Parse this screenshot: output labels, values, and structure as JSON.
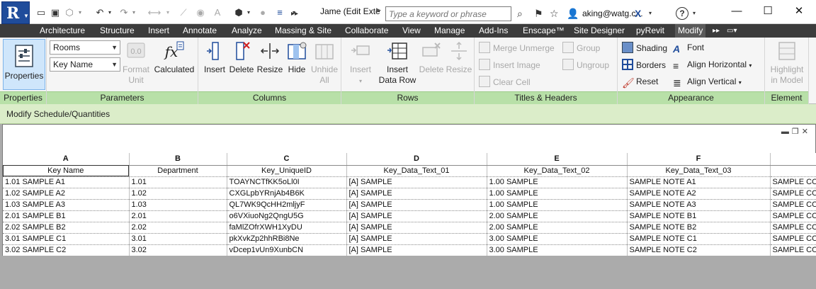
{
  "titlebar": {
    "doc_title": "Jame (Edit Exte",
    "search_placeholder": "Type a keyword or phrase",
    "user_name": "aking@watg.c...",
    "help_label": "?",
    "minimize": "—",
    "maximize": "☐",
    "close": "✕"
  },
  "tabs": [
    "Architecture",
    "Structure",
    "Insert",
    "Annotate",
    "Analyze",
    "Massing & Site",
    "Collaborate",
    "View",
    "Manage",
    "Add-Ins",
    "Enscape™",
    "Site Designer",
    "pyRevit",
    "Modify"
  ],
  "ribbon": {
    "properties": {
      "button": "Properties",
      "group": "Properties"
    },
    "parameters": {
      "group": "Parameters",
      "dropdown1": "Rooms",
      "dropdown2": "Key Name",
      "format_unit_line1": "Format",
      "format_unit_line2": "Unit",
      "calculated": "Calculated"
    },
    "columns": {
      "group": "Columns",
      "insert": "Insert",
      "delete": "Delete",
      "resize": "Resize",
      "hide": "Hide",
      "unhide_line1": "Unhide",
      "unhide_line2": "All"
    },
    "rows": {
      "group": "Rows",
      "insert": "Insert",
      "insert_data_row_line1": "Insert",
      "insert_data_row_line2": "Data Row",
      "delete": "Delete",
      "resize": "Resize"
    },
    "titles_headers": {
      "group": "Titles & Headers",
      "merge_unmerge": "Merge  Unmerge",
      "insert_image": "Insert  Image",
      "clear_cell": "Clear  Cell",
      "group_btn": "Group",
      "ungroup": "Ungroup"
    },
    "appearance": {
      "group": "Appearance",
      "shading": "Shading",
      "borders": "Borders",
      "reset": "Reset",
      "font": "Font",
      "align_horizontal": "Align  Horizontal",
      "align_vertical": "Align  Vertical"
    },
    "element": {
      "group": "Element",
      "highlight_line1": "Highlight",
      "highlight_line2": "in Model"
    }
  },
  "context_label": "Modify Schedule/Quantities",
  "schedule": {
    "column_letters": [
      "A",
      "B",
      "C",
      "D",
      "E",
      "F",
      ""
    ],
    "headers": [
      "Key Name",
      "Department",
      "Key_UniqueID",
      "Key_Data_Text_01",
      "Key_Data_Text_02",
      "Key_Data_Text_03",
      ""
    ],
    "rows": [
      [
        "1.01 SAMPLE A1",
        "1.01",
        "TOAYNCTfKK5oLl0I",
        "[A] SAMPLE",
        "1.00 SAMPLE",
        "SAMPLE NOTE A1",
        "SAMPLE CO"
      ],
      [
        "1.02 SAMPLE A2",
        "1.02",
        "CXGLpbYRnjAb4B6K",
        "[A] SAMPLE",
        "1.00 SAMPLE",
        "SAMPLE NOTE A2",
        "SAMPLE CO"
      ],
      [
        "1.03 SAMPLE A3",
        "1.03",
        "QL7WK9QcHH2mljyF",
        "[A] SAMPLE",
        "1.00 SAMPLE",
        "SAMPLE NOTE A3",
        "SAMPLE CO"
      ],
      [
        "2.01 SAMPLE B1",
        "2.01",
        "o6VXiuoNg2QngU5G",
        "[A] SAMPLE",
        "2.00 SAMPLE",
        "SAMPLE NOTE B1",
        "SAMPLE CO"
      ],
      [
        "2.02 SAMPLE B2",
        "2.02",
        "faMlZOfrXWH1XyDU",
        "[A] SAMPLE",
        "2.00 SAMPLE",
        "SAMPLE NOTE B2",
        "SAMPLE CO"
      ],
      [
        "3.01 SAMPLE C1",
        "3.01",
        "pkXvkZp2hhRBi8Ne",
        "[A] SAMPLE",
        "3.00 SAMPLE",
        "SAMPLE NOTE C1",
        "SAMPLE CO"
      ],
      [
        "3.02 SAMPLE C2",
        "3.02",
        "vDcep1vUn9XunbCN",
        "[A] SAMPLE",
        "3.00 SAMPLE",
        "SAMPLE NOTE C2",
        "SAMPLE CO"
      ]
    ]
  },
  "colors": {
    "accent": "#1f4c9b",
    "group_label": "#b8e0a8",
    "context_bar": "#dbedc9",
    "tab_bar": "#3c3c3c"
  }
}
